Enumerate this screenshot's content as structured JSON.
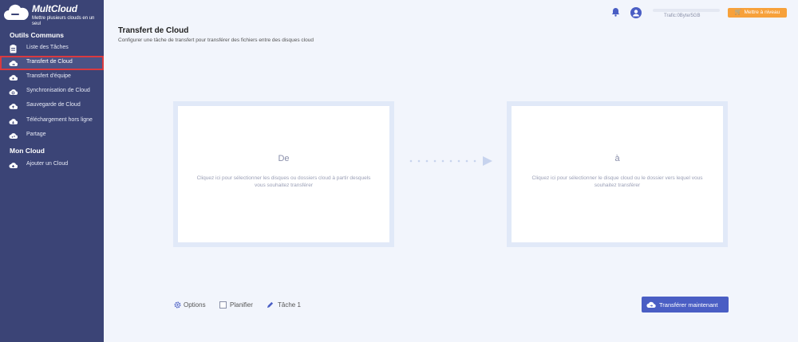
{
  "brand": {
    "name": "MultCloud",
    "tagline": "Mettre plusieurs clouds en un seul"
  },
  "sidebar": {
    "sections": [
      {
        "label": "Outils Communs"
      },
      {
        "label": "Mon Cloud"
      }
    ],
    "items": [
      {
        "label": "Liste des Tâches",
        "icon": "task-list-icon"
      },
      {
        "label": "Transfert de Cloud",
        "icon": "cloud-transfer-icon",
        "active": true
      },
      {
        "label": "Transfert d'équipe",
        "icon": "team-transfer-icon"
      },
      {
        "label": "Synchronisation de Cloud",
        "icon": "cloud-sync-icon"
      },
      {
        "label": "Sauvegarde de Cloud",
        "icon": "cloud-backup-icon"
      },
      {
        "label": "Téléchargement hors ligne",
        "icon": "offline-download-icon"
      },
      {
        "label": "Partage",
        "icon": "share-icon"
      },
      {
        "label": "Ajouter un Cloud",
        "icon": "add-cloud-icon"
      }
    ]
  },
  "header": {
    "quota": "Trafic:0Byte/5GB",
    "upgrade": "Mettre à niveau"
  },
  "main": {
    "title": "Transfert de Cloud",
    "subtitle": "Configurer une tâche de transfert pour transférer des fichiers entre des disques cloud",
    "from": {
      "title": "De",
      "desc": "Cliquez ici pour sélectionner les disques ou dossiers cloud à partir desquels vous souhaitez transférer"
    },
    "to": {
      "title": "à",
      "desc": "Cliquez ici pour sélectionner le disque cloud ou le dossier vers lequel vous souhaitez transférer"
    }
  },
  "footer": {
    "options": "Options",
    "schedule": "Planifier",
    "task": "Tâche 1",
    "transfer": "Transférer maintenant"
  },
  "colors": {
    "sidebar": "#3b4476",
    "accent": "#4a5ec4",
    "upgrade": "#f7a13a",
    "active_border": "#d93a40"
  }
}
